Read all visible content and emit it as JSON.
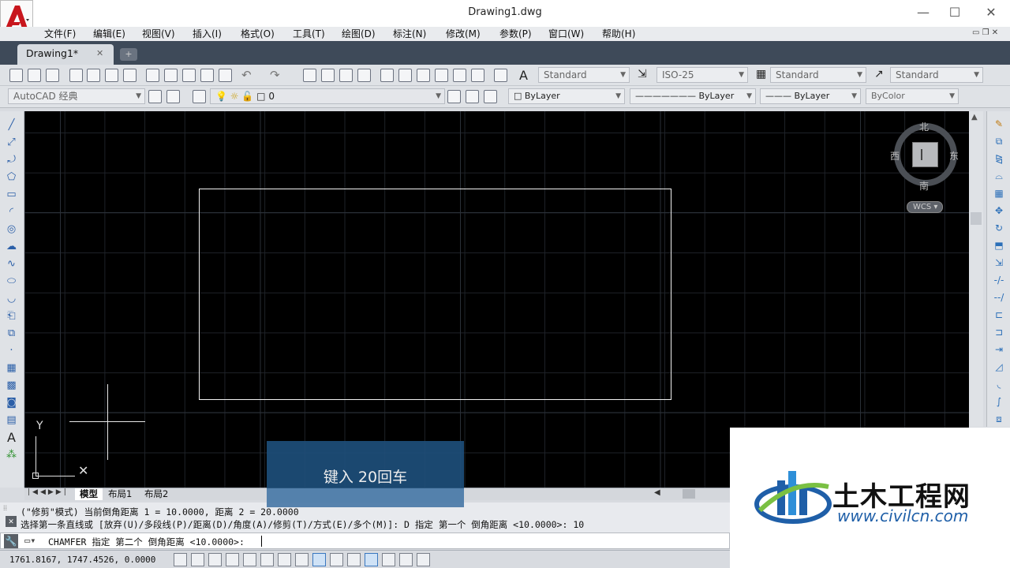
{
  "window": {
    "title": "Drawing1.dwg",
    "minimize": "—",
    "maximize": "☐",
    "close": "✕"
  },
  "menu": [
    "文件(F)",
    "编辑(E)",
    "视图(V)",
    "插入(I)",
    "格式(O)",
    "工具(T)",
    "绘图(D)",
    "标注(N)",
    "修改(M)",
    "参数(P)",
    "窗口(W)",
    "帮助(H)"
  ],
  "tabs": {
    "active": "Drawing1*",
    "close": "✕",
    "add": "+"
  },
  "toolbar1": {
    "text_style": "Standard",
    "dim_style": "ISO-25",
    "table_style": "Standard",
    "mleader_style": "Standard"
  },
  "toolbar2": {
    "workspace": "AutoCAD 经典",
    "layer": "0",
    "color": "ByLayer",
    "linetype": "ByLayer",
    "lineweight": "ByLayer",
    "plotstyle": "ByColor"
  },
  "viewcube": {
    "north": "北",
    "south": "南",
    "east": "东",
    "west": "西",
    "wcs": "WCS"
  },
  "ucs": {
    "y_label": "Y"
  },
  "layout_tabs": [
    "模型",
    "布局1",
    "布局2"
  ],
  "command": {
    "history_1": "(\"修剪\"模式) 当前倒角距离 1 = 10.0000, 距离 2 = 20.0000",
    "history_2": "选择第一条直线或 [放弃(U)/多段线(P)/距离(D)/角度(A)/修剪(T)/方式(E)/多个(M)]: D 指定 第一个 倒角距离 <10.0000>: 10",
    "prompt": "CHAMFER 指定 第二个 倒角距离 <10.0000>:"
  },
  "status": {
    "coordinates": "1761.8167, 1747.4526, 0.0000"
  },
  "hint": {
    "text": "键入 20回车"
  },
  "watermark": {
    "name": "土木工程网",
    "url": "www.civilcn.com"
  },
  "colors": {
    "canvas": "#000000",
    "hint_bg": "#1e4e79",
    "brand_blue": "#1f5fa8",
    "tab_bar": "#3e4a59"
  }
}
